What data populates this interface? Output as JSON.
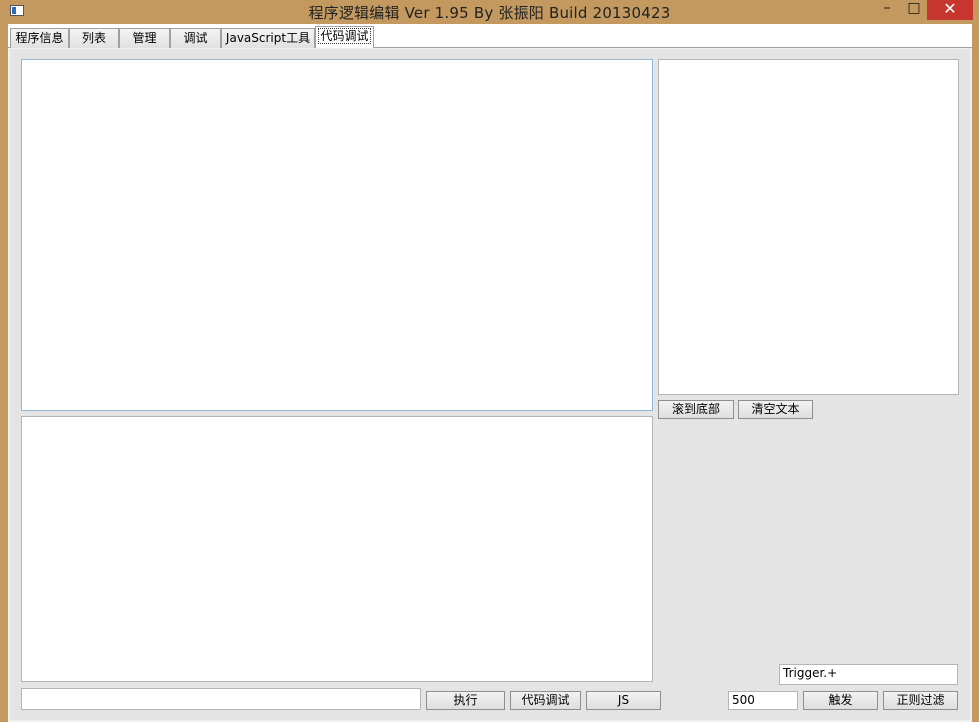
{
  "window": {
    "title": "程序逻辑编辑 Ver 1.95 By 张振阳 Build 20130423",
    "minimize_glyph": "–",
    "maximize_glyph": "□",
    "close_glyph": "✕"
  },
  "tabs": [
    {
      "label": "程序信息",
      "active": false
    },
    {
      "label": "列表",
      "active": false
    },
    {
      "label": "管理",
      "active": false
    },
    {
      "label": "调试",
      "active": false
    },
    {
      "label": "JavaScript工具",
      "active": false
    },
    {
      "label": "代码调试",
      "active": true
    }
  ],
  "right_panel": {
    "scroll_bottom_label": "滚到底部",
    "clear_text_label": "清空文本",
    "filter_value": "Trigger.+",
    "interval_value": "500",
    "trigger_label": "触发",
    "regex_filter_label": "正则过滤"
  },
  "bottom_bar": {
    "command_value": "",
    "execute_label": "执行",
    "code_debug_label": "代码调试",
    "js_label": "JS"
  },
  "colors": {
    "window_frame": "#c3995f",
    "close_button": "#c7352f",
    "tab_page_bg": "#e4e4e4"
  }
}
